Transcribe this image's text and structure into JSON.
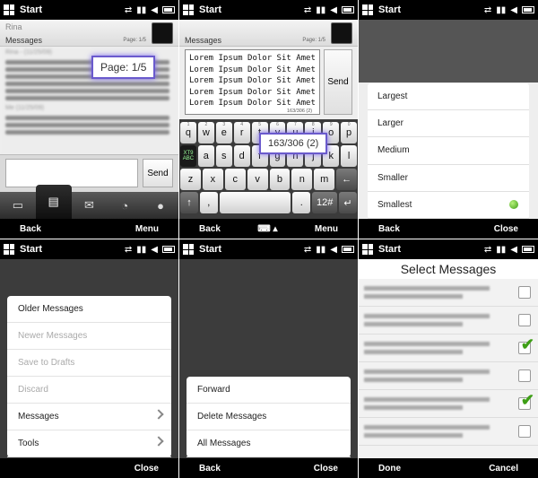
{
  "status": {
    "start": "Start"
  },
  "colors": {
    "accent_callout": "#6a5acd",
    "radio_selected": "#3c9a12",
    "check": "#3e9f16"
  },
  "panel1": {
    "contact": "Rina",
    "messages_label": "Messages",
    "page_small": "Page: 1/5",
    "page_callout": "Page: 1/5",
    "dates": [
      "Rina - (11/25/09)",
      "Me (11/25/09)"
    ],
    "send": "Send",
    "tabs": [
      {
        "icon": "contact-card-icon"
      },
      {
        "icon": "conversation-icon"
      },
      {
        "icon": "envelope-icon"
      },
      {
        "icon": "call-history-icon"
      },
      {
        "icon": "person-icon"
      }
    ],
    "softkey_left": "Back",
    "softkey_right": "Menu"
  },
  "panel2": {
    "messages_label": "Messages",
    "page_small": "Page: 1/5",
    "text": "Lorem Ipsum Dolor Sit Amet\nLorem Ipsum Dolor Sit Amet\nLorem Ipsum Dolor Sit Amet\nLorem Ipsum Dolor Sit Amet\nLorem Ipsum Dolor Sit Amet",
    "counter_small": "163/306 (2)",
    "counter_callout": "163/306 (2)",
    "send": "Send",
    "keys_row1": [
      "q",
      "w",
      "e",
      "r",
      "t",
      "y",
      "u",
      "i",
      "o",
      "p"
    ],
    "keys_row1_alt": [
      "1",
      "2",
      "3",
      "4",
      "5",
      "6",
      "7",
      "8",
      "9",
      "0"
    ],
    "keys_row2": [
      "a",
      "s",
      "d",
      "f",
      "g",
      "h",
      "j",
      "k",
      "l"
    ],
    "keys_row3": [
      "z",
      "x",
      "c",
      "v",
      "b",
      "n",
      "m"
    ],
    "xt9_top": "XT9",
    "xt9_bottom": "ABC",
    "shift": "↑",
    "backspace": "←",
    "enter": "↵",
    "num": "12#",
    "comma": ",",
    "period": ".",
    "softkey_left": "Back",
    "softkey_right": "Menu"
  },
  "panel3": {
    "font_sizes": [
      "Largest",
      "Larger",
      "Medium",
      "Smaller",
      "Smallest"
    ],
    "selected": "Smallest",
    "softkey_left": "Back",
    "softkey_right": "Close"
  },
  "panel4": {
    "menu": [
      {
        "label": "Older Messages",
        "enabled": true,
        "submenu": false
      },
      {
        "label": "Newer Messages",
        "enabled": false,
        "submenu": false
      },
      {
        "label": "Save to Drafts",
        "enabled": false,
        "submenu": false
      },
      {
        "label": "Discard",
        "enabled": false,
        "submenu": false
      },
      {
        "label": "Messages",
        "enabled": true,
        "submenu": true
      },
      {
        "label": "Tools",
        "enabled": true,
        "submenu": true
      }
    ],
    "softkey_right": "Close"
  },
  "panel5": {
    "menu": [
      "Forward",
      "Delete Messages",
      "All Messages"
    ],
    "softkey_left": "Back",
    "softkey_right": "Close"
  },
  "panel6": {
    "title": "Select Messages",
    "rows": [
      {
        "checked": false
      },
      {
        "checked": false
      },
      {
        "checked": true
      },
      {
        "checked": false
      },
      {
        "checked": true
      },
      {
        "checked": false
      }
    ],
    "softkey_left": "Done",
    "softkey_right": "Cancel"
  }
}
